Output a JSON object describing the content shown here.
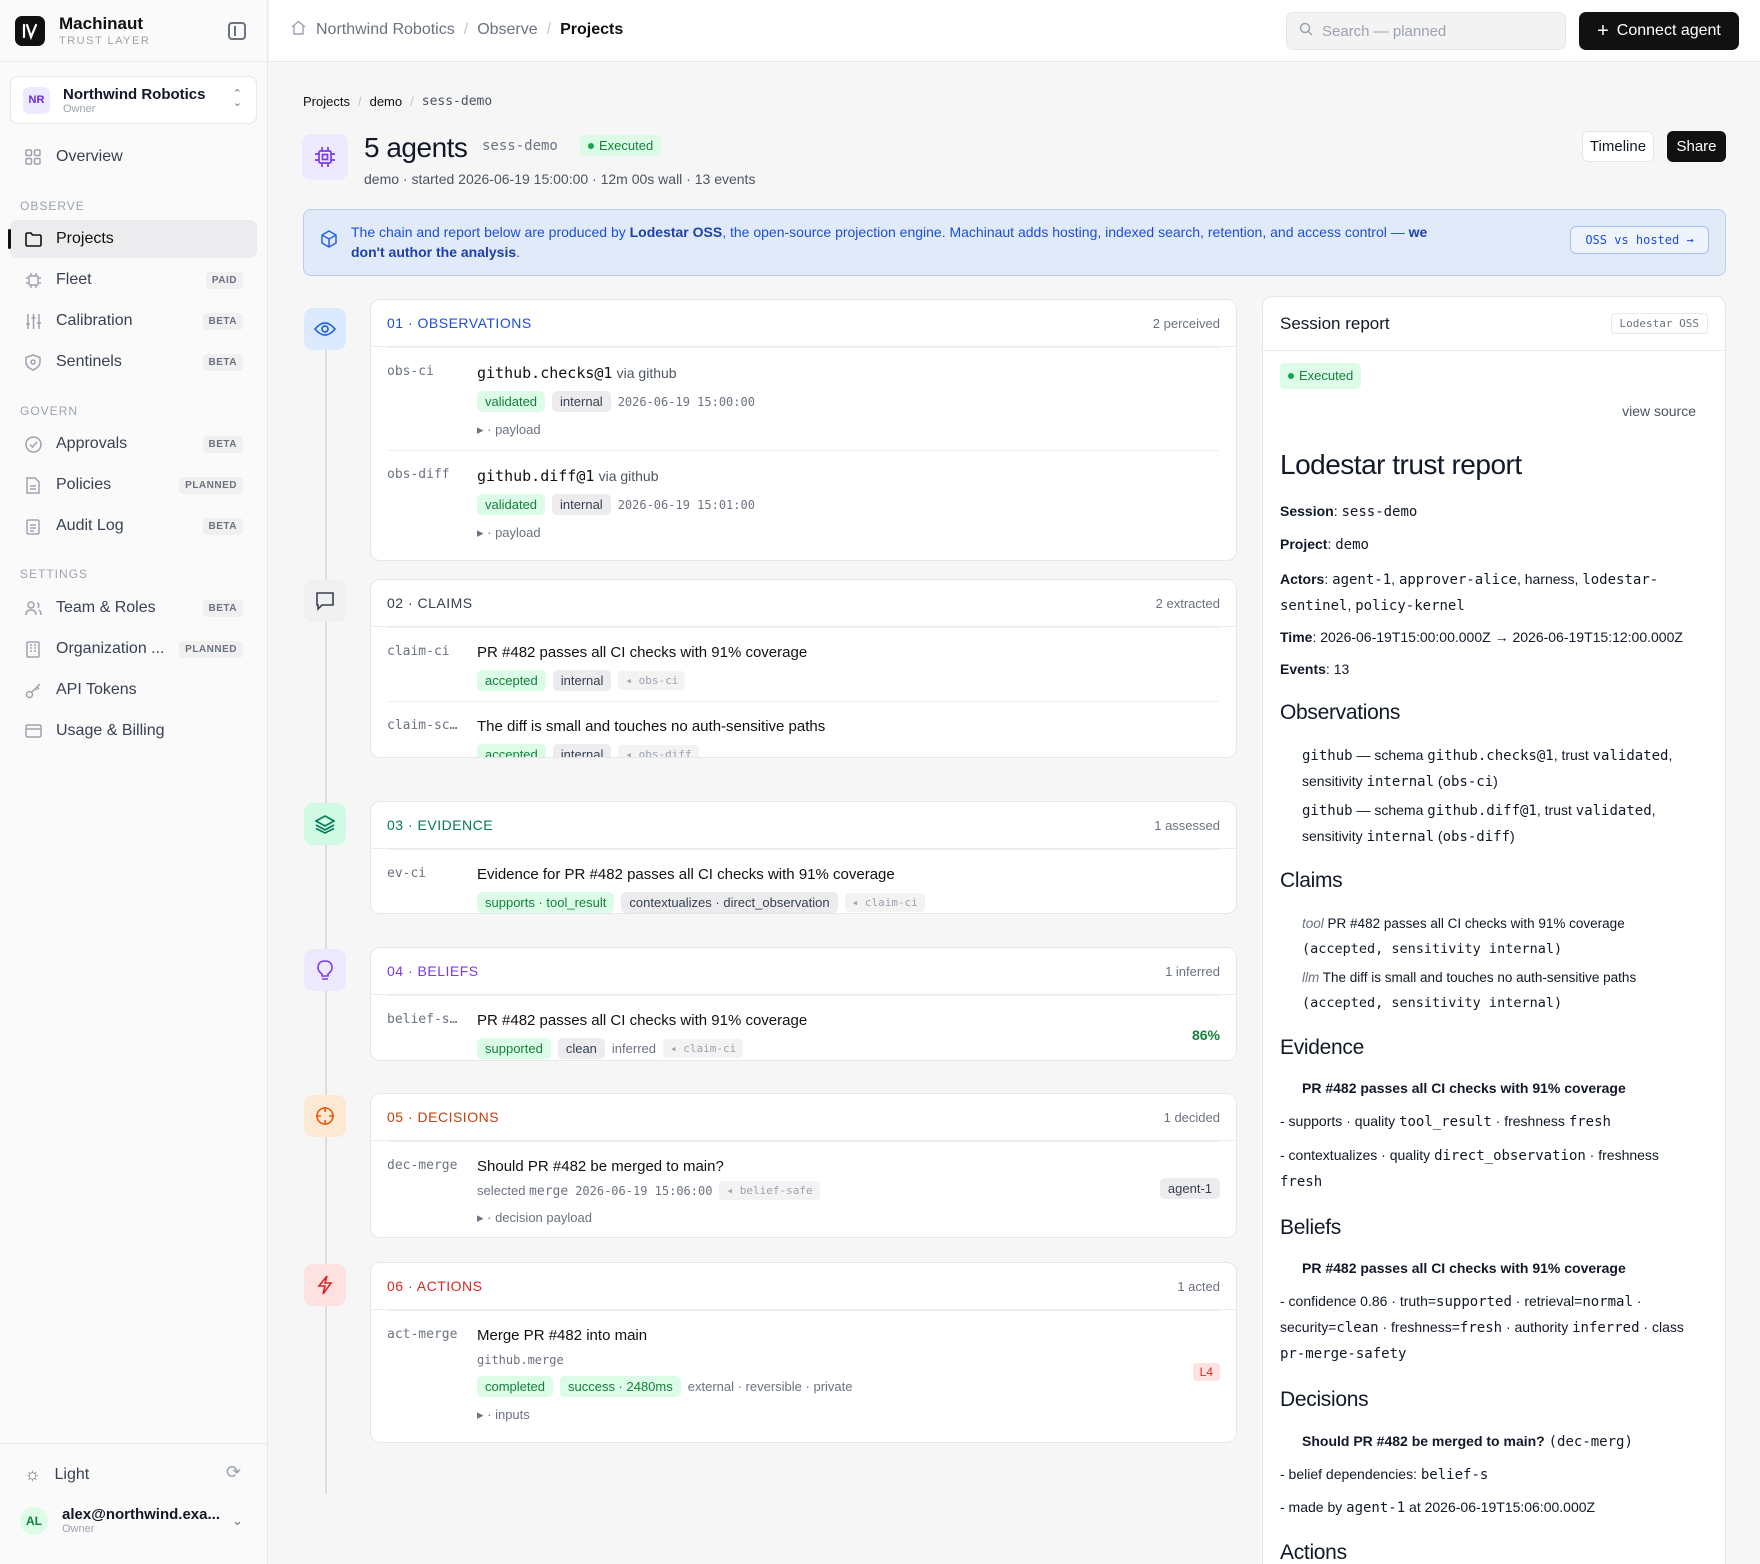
{
  "brand": {
    "name": "Machinaut",
    "sub": "TRUST LAYER"
  },
  "org": {
    "initials": "NR",
    "name": "Northwind Robotics",
    "role": "Owner"
  },
  "nav": {
    "overview": "Overview",
    "observe_section": "OBSERVE",
    "projects": "Projects",
    "fleet": "Fleet",
    "fleet_badge": "PAID",
    "calibration": "Calibration",
    "calibration_badge": "BETA",
    "sentinels": "Sentinels",
    "sentinels_badge": "BETA",
    "govern_section": "GOVERN",
    "approvals": "Approvals",
    "approvals_badge": "BETA",
    "policies": "Policies",
    "policies_badge": "PLANNED",
    "audit": "Audit Log",
    "audit_badge": "BETA",
    "settings_section": "SETTINGS",
    "team": "Team & Roles",
    "team_badge": "BETA",
    "organization": "Organization ...",
    "organization_badge": "PLANNED",
    "tokens": "API Tokens",
    "billing": "Usage & Billing"
  },
  "footer": {
    "theme": "Light",
    "user_initials": "AL",
    "user_email": "alex@northwind.exa...",
    "user_role": "Owner"
  },
  "topbar": {
    "crumb1": "Northwind Robotics",
    "crumb2": "Observe",
    "crumb3": "Projects",
    "search_placeholder": "Search — planned",
    "connect": "Connect agent"
  },
  "page": {
    "crumb1": "Projects",
    "crumb2": "demo",
    "crumb3": "sess-demo",
    "title": "5 agents",
    "session": "sess-demo",
    "status": "Executed",
    "meta": "demo · started 2026-06-19 15:00:00 · 12m 00s wall · 13 events",
    "timeline_btn": "Timeline",
    "share_btn": "Share"
  },
  "banner": {
    "text1": "The chain and report below are produced by ",
    "bold1": "Lodestar OSS",
    "text2": ", the open-source projection engine. Machinaut adds hosting, indexed search, retention, and access control — ",
    "bold2": "we don't author the analysis",
    "text3": ".",
    "button": "OSS vs hosted →"
  },
  "observations": {
    "title": "01 · OBSERVATIONS",
    "count": "2 perceived",
    "rows": [
      {
        "id": "obs-ci",
        "schema": "github.checks@1",
        "via": "via github",
        "trust": "validated",
        "sens": "internal",
        "ts": "2026-06-19 15:00:00",
        "payload": "▸ · payload"
      },
      {
        "id": "obs-diff",
        "schema": "github.diff@1",
        "via": "via github",
        "trust": "validated",
        "sens": "internal",
        "ts": "2026-06-19 15:01:00",
        "payload": "▸ · payload"
      }
    ]
  },
  "claims": {
    "title": "02 · CLAIMS",
    "count": "2 extracted",
    "rows": [
      {
        "id": "claim-ci",
        "text": "PR #482 passes all CI checks with 91% coverage",
        "status": "accepted",
        "sens": "internal",
        "ref": "◂ obs-ci"
      },
      {
        "id": "claim-sc…",
        "text": "The diff is small and touches no auth-sensitive paths",
        "status": "accepted",
        "sens": "internal",
        "ref": "◂ obs-diff"
      }
    ]
  },
  "evidence": {
    "title": "03 · EVIDENCE",
    "count": "1 assessed",
    "row": {
      "id": "ev-ci",
      "text": "Evidence for PR #482 passes all CI checks with 91% coverage",
      "tag1": "supports · tool_result",
      "tag2": "contextualizes · direct_observation",
      "ref": "◂ claim-ci"
    }
  },
  "beliefs": {
    "title": "04 · BELIEFS",
    "count": "1 inferred",
    "row": {
      "id": "belief-s…",
      "text": "PR #482 passes all CI checks with 91% coverage",
      "tag1": "supported",
      "tag2": "clean",
      "muted": "inferred",
      "ref": "◂ claim-ci",
      "confidence": "86%"
    }
  },
  "decisions": {
    "title": "05 · DECISIONS",
    "count": "1 decided",
    "row": {
      "id": "dec-merge",
      "text": "Should PR #482 be merged to main?",
      "selected_label": "selected",
      "selected": "merge",
      "ts": "2026-06-19 15:06:00",
      "ref": "◂ belief-safe",
      "agent": "agent-1",
      "payload": "▸ · decision payload"
    }
  },
  "actions": {
    "title": "06 · ACTIONS",
    "count": "1 acted",
    "row": {
      "id": "act-merge",
      "text": "Merge PR #482 into main",
      "tool": "github.merge",
      "tag1": "completed",
      "tag2": "success · 2480ms",
      "muted": "external · reversible · private",
      "level": "L4",
      "payload": "▸ · inputs"
    }
  },
  "report": {
    "title": "Session report",
    "badge": "Lodestar OSS",
    "status": "Executed",
    "view_source": "view source",
    "h1": "Lodestar trust report",
    "session_label": "Session",
    "session": "sess-demo",
    "project_label": "Project",
    "project": "demo",
    "actors_label": "Actors",
    "actor1": "agent-1",
    "actor2": "approver-alice",
    "actor3": "harness",
    "actor4": "lodestar-sentinel",
    "actor5": "policy-kernel",
    "time_label": "Time",
    "time": "2026-06-19T15:00:00.000Z → 2026-06-19T15:12:00.000Z",
    "events_label": "Events",
    "events": "13",
    "obs_h": "Observations",
    "obs1_src": "github",
    "obs1_schema": "github.checks@1",
    "obs1_trust": "validated",
    "obs1_sens": "internal",
    "obs1_id": "obs-ci",
    "obs2_src": "github",
    "obs2_schema": "github.diff@1",
    "obs2_trust": "validated",
    "obs2_sens": "internal",
    "obs2_id": "obs-diff",
    "claims_h": "Claims",
    "claim1_kind": "tool",
    "claim1_text": "PR #482 passes all CI checks with 91% coverage",
    "claim1_meta": "(accepted, sensitivity internal)",
    "claim2_kind": "llm",
    "claim2_text": "The diff is small and touches no auth-sensitive paths",
    "claim2_meta": "(accepted, sensitivity internal)",
    "evidence_h": "Evidence",
    "ev_title": "PR #482 passes all CI checks with 91% coverage",
    "ev1_a": "- supports · quality ",
    "ev1_q": "tool_result",
    "ev1_b": " · freshness ",
    "ev1_f": "fresh",
    "ev2_a": "- contextualizes · quality ",
    "ev2_q": "direct_observation",
    "ev2_b": " · freshness ",
    "ev2_f": "fresh",
    "beliefs_h": "Beliefs",
    "bel_title": "PR #482 passes all CI checks with 91% coverage",
    "bel_line_a": "- confidence 0.86 · truth=",
    "bel_truth": "supported",
    "bel_line_b": " · retrieval=",
    "bel_retr": "normal",
    "bel_line_c": " · security=",
    "bel_sec": "clean",
    "bel_line_d": " · freshness=",
    "bel_fresh": "fresh",
    "bel_line_e": " · authority ",
    "bel_auth": "inferred",
    "bel_line_f": " · class ",
    "bel_class": "pr-merge-safety",
    "decisions_h": "Decisions",
    "dec_title": "Should PR #482 be merged to main?",
    "dec_id": "(dec-merg)",
    "dec1_a": "- belief dependencies: ",
    "dec1_v": "belief-s",
    "dec2_a": "- made by ",
    "dec2_v": "agent-1",
    "dec2_b": " at 2026-06-19T15:06:00.000Z",
    "actions_h": "Actions"
  }
}
